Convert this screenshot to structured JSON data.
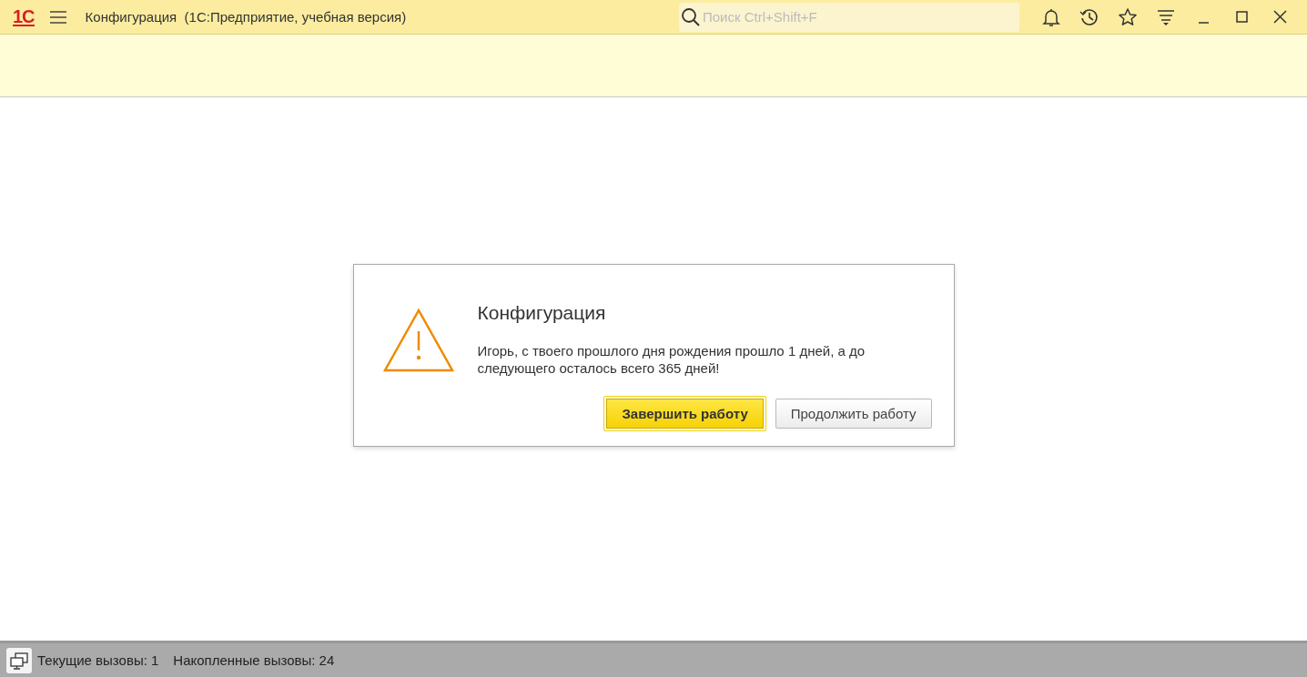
{
  "window": {
    "logo": "1С",
    "title": "Конфигурация  (1С:Предприятие, учебная версия)"
  },
  "search": {
    "placeholder": "Поиск Ctrl+Shift+F"
  },
  "dialog": {
    "title": "Конфигурация",
    "message": "Игорь, с твоего прошлого дня рождения прошло 1 дней, а до следующего осталось всего 365 дней!",
    "buttons": [
      {
        "label": "Завершить работу",
        "kind": "primary",
        "selected": true
      },
      {
        "label": "Продолжить работу",
        "kind": "secondary",
        "selected": false
      }
    ]
  },
  "status_bar": {
    "items": [
      "Текущие вызовы: 1",
      "Накопленные вызовы: 24"
    ]
  }
}
